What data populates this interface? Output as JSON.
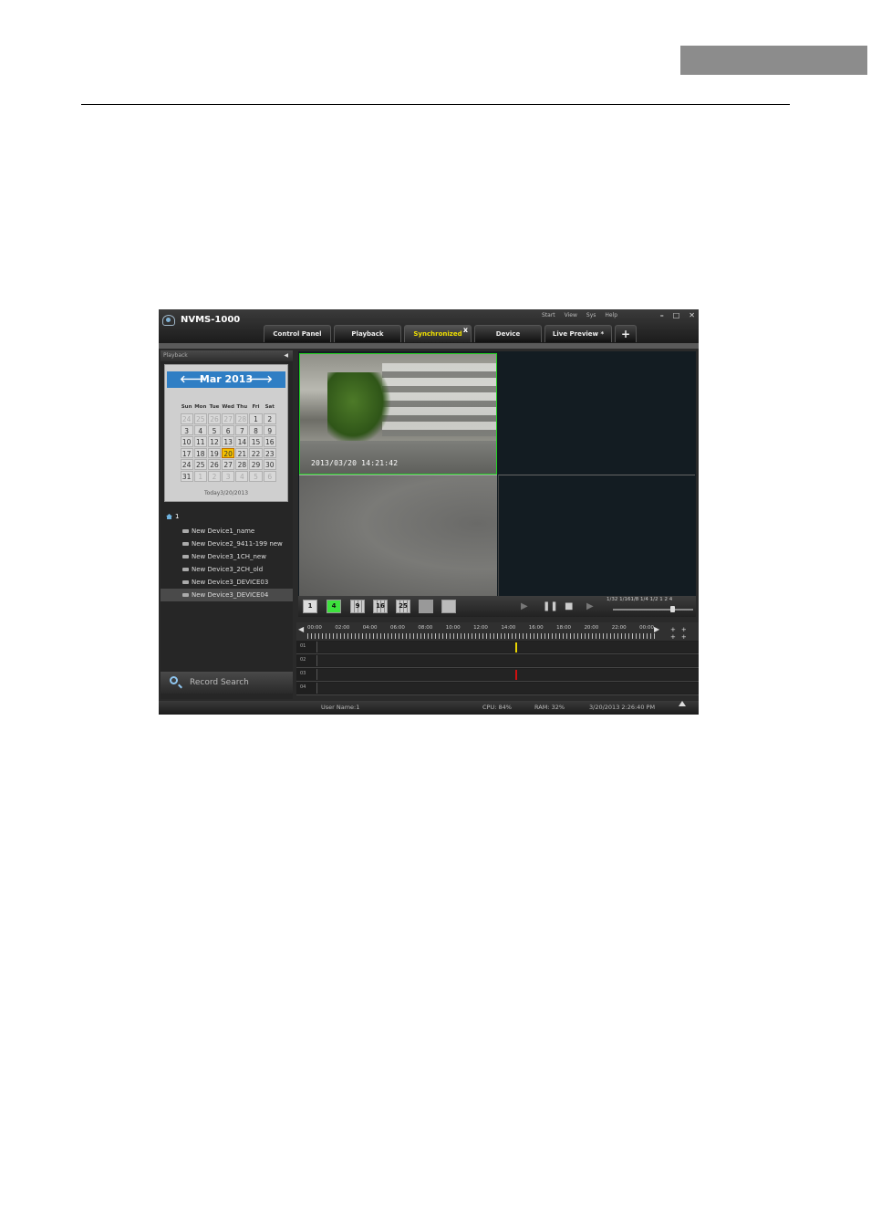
{
  "app": {
    "title": "NVMS-1000",
    "menus": [
      "Start",
      "View",
      "Sys",
      "Help"
    ],
    "window_controls": {
      "minimize": "–",
      "maximize": "□",
      "close": "✕"
    }
  },
  "tabs": [
    {
      "label": "Control Panel",
      "active": false
    },
    {
      "label": "Playback",
      "active": false
    },
    {
      "label": "Synchronized",
      "active": true,
      "close": "x"
    },
    {
      "label": "Device",
      "active": false
    },
    {
      "label": "Live Preview *",
      "active": false
    },
    {
      "label": "+",
      "active": false
    }
  ],
  "left_panel": {
    "header": "Playback",
    "header_arrow": "◀",
    "calendar": {
      "month_year": "Mar  2013",
      "prev": "🡐",
      "next": "🡒",
      "weekdays": [
        "Sun",
        "Mon",
        "Tue",
        "Wed",
        "Thu",
        "Fri",
        "Sat"
      ],
      "days": [
        "24",
        "25",
        "26",
        "27",
        "28",
        "1",
        "2",
        "3",
        "4",
        "5",
        "6",
        "7",
        "8",
        "9",
        "10",
        "11",
        "12",
        "13",
        "14",
        "15",
        "16",
        "17",
        "18",
        "19",
        "20",
        "21",
        "22",
        "23",
        "24",
        "25",
        "26",
        "27",
        "28",
        "29",
        "30",
        "31",
        "1",
        "2",
        "3",
        "4",
        "5",
        "6"
      ],
      "dim_indices": [
        0,
        1,
        2,
        3,
        4,
        36,
        37,
        38,
        39,
        40,
        41
      ],
      "today_index": 24,
      "today_label": "Today3/20/2013"
    },
    "tree": {
      "root": "1",
      "devices": [
        "New Device1_name",
        "New Device2_9411-199 new",
        "New Device3_1CH_new",
        "New Device3_2CH_old",
        "New Device3_DEVICE03",
        "New Device3_DEVICE04"
      ],
      "selected_index": 5
    },
    "record_search": "Record Search"
  },
  "video": {
    "timestamp": "2013/03/20 14:21:42"
  },
  "controls": {
    "layouts": [
      "1",
      "4",
      "9",
      "16",
      "25"
    ],
    "active_layout": "4",
    "speeds": "1/32 1/161/8 1/4 1/2   1    2    4"
  },
  "timeline": {
    "hours": [
      "00:00",
      "02:00",
      "04:00",
      "06:00",
      "08:00",
      "10:00",
      "12:00",
      "14:00",
      "16:00",
      "18:00",
      "20:00",
      "22:00",
      "00:00"
    ],
    "channels": [
      "01",
      "02",
      "03",
      "04"
    ],
    "zoom": "++ ++",
    "markers": [
      {
        "channel": 0,
        "hour": 14.35,
        "color": "#e8d400"
      },
      {
        "channel": 2,
        "hour": 14.35,
        "color": "#d01010"
      }
    ]
  },
  "status": {
    "user": "User Name:1",
    "cpu": "CPU: 84%",
    "ram": "RAM: 32%",
    "datetime": "3/20/2013 2:26:40 PM"
  }
}
